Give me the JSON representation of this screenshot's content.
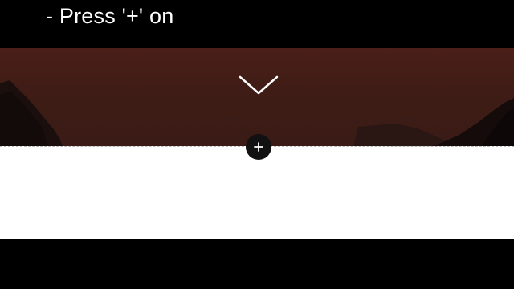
{
  "caption": {
    "text": "- Press '+' on"
  },
  "hero": {
    "background_color": "#3f1c16",
    "scroll_indicator_icon": "chevron-down-icon"
  },
  "editor": {
    "add_section_icon": "plus-icon",
    "divider_style": "dashed",
    "content_background": "#ffffff"
  }
}
